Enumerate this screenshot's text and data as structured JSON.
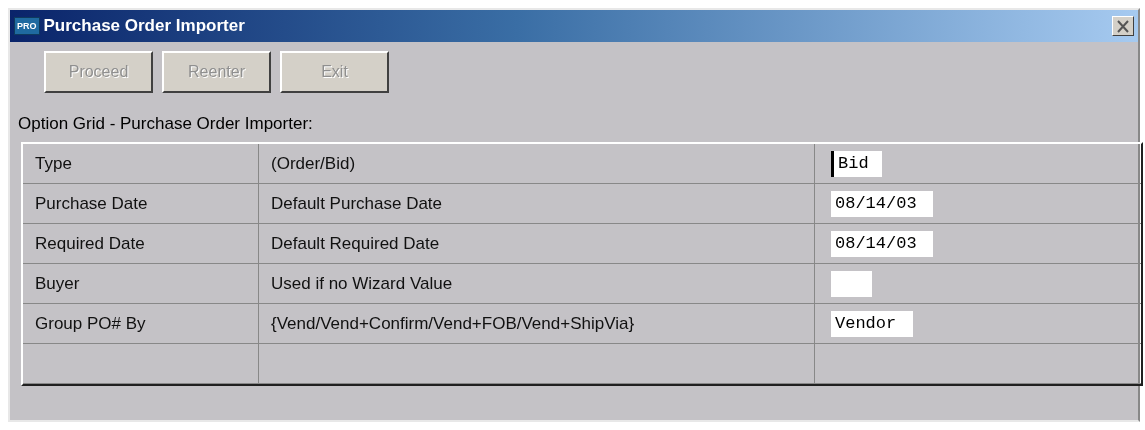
{
  "window": {
    "title": "Purchase Order Importer",
    "icon": "PRO"
  },
  "buttons": [
    {
      "label": "Proceed",
      "disabled": true
    },
    {
      "label": "Reenter",
      "disabled": true
    },
    {
      "label": "Exit",
      "disabled": true
    }
  ],
  "grid_label": "Option Grid - Purchase Order Importer:",
  "rows": [
    {
      "option": "Type",
      "description": "(Order/Bid)",
      "field": {
        "value": "Bid",
        "focused": true
      }
    },
    {
      "option": "Purchase Date",
      "description": "Default Purchase Date",
      "field": {
        "value": "08/14/03",
        "focused": false
      }
    },
    {
      "option": "Required Date",
      "description": "Default Required Date",
      "field": {
        "value": "08/14/03",
        "focused": false
      }
    },
    {
      "option": "Buyer",
      "description": "Used if no Wizard Value",
      "field": {
        "focused": false
      }
    },
    {
      "option": "Group PO# By",
      "description": "{Vend/Vend+Confirm/Vend+FOB/Vend+ShipVia}",
      "field": {
        "value": "Vendor",
        "focused": false
      }
    },
    {}
  ]
}
